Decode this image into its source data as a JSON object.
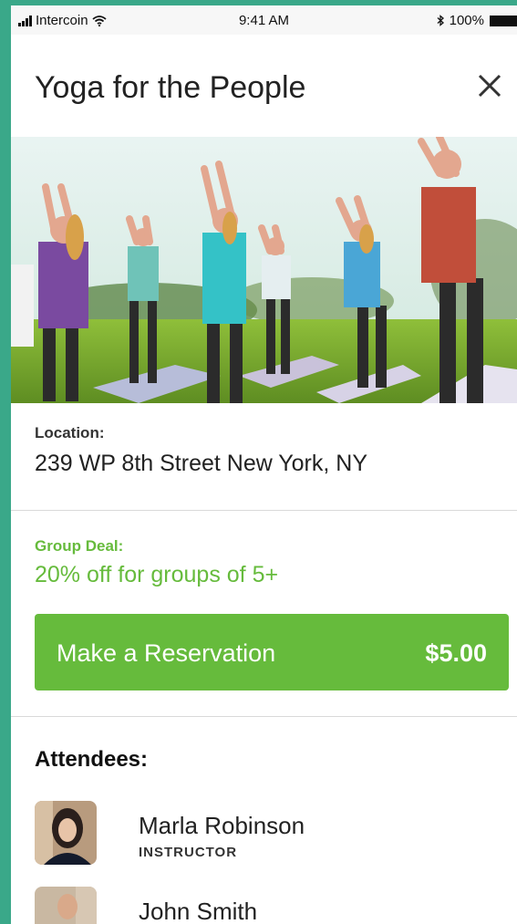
{
  "status_bar": {
    "carrier": "Intercoin",
    "time": "9:41 AM",
    "battery": "100%",
    "icons": [
      "signal-icon",
      "wifi-icon",
      "bluetooth-icon",
      "battery-icon"
    ]
  },
  "header": {
    "title": "Yoga for the People",
    "close_icon": "close-icon"
  },
  "hero": {
    "image": "yoga-class-outdoor-photo"
  },
  "location": {
    "label": "Location:",
    "value": "239 WP 8th Street New York, NY"
  },
  "group_deal": {
    "label": "Group Deal:",
    "value": "20% off for groups of 5+"
  },
  "reservation": {
    "label": "Make a Reservation",
    "price": "$5.00"
  },
  "attendees": {
    "title": "Attendees:",
    "items": [
      {
        "name": "Marla Robinson",
        "role": "INSTRUCTOR"
      },
      {
        "name": "John Smith",
        "role": ""
      }
    ]
  },
  "colors": {
    "accent": "#66bb3c",
    "background": "#3aa889"
  }
}
